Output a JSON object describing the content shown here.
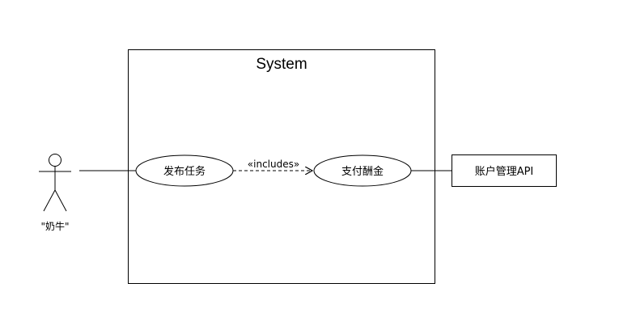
{
  "system": {
    "title": "System"
  },
  "actor": {
    "label": "\"奶牛\""
  },
  "use_cases": [
    {
      "label": "发布任务"
    },
    {
      "label": "支付酬金"
    }
  ],
  "relationship": {
    "label": "«includes»"
  },
  "external_system": {
    "label": "账户管理API"
  }
}
